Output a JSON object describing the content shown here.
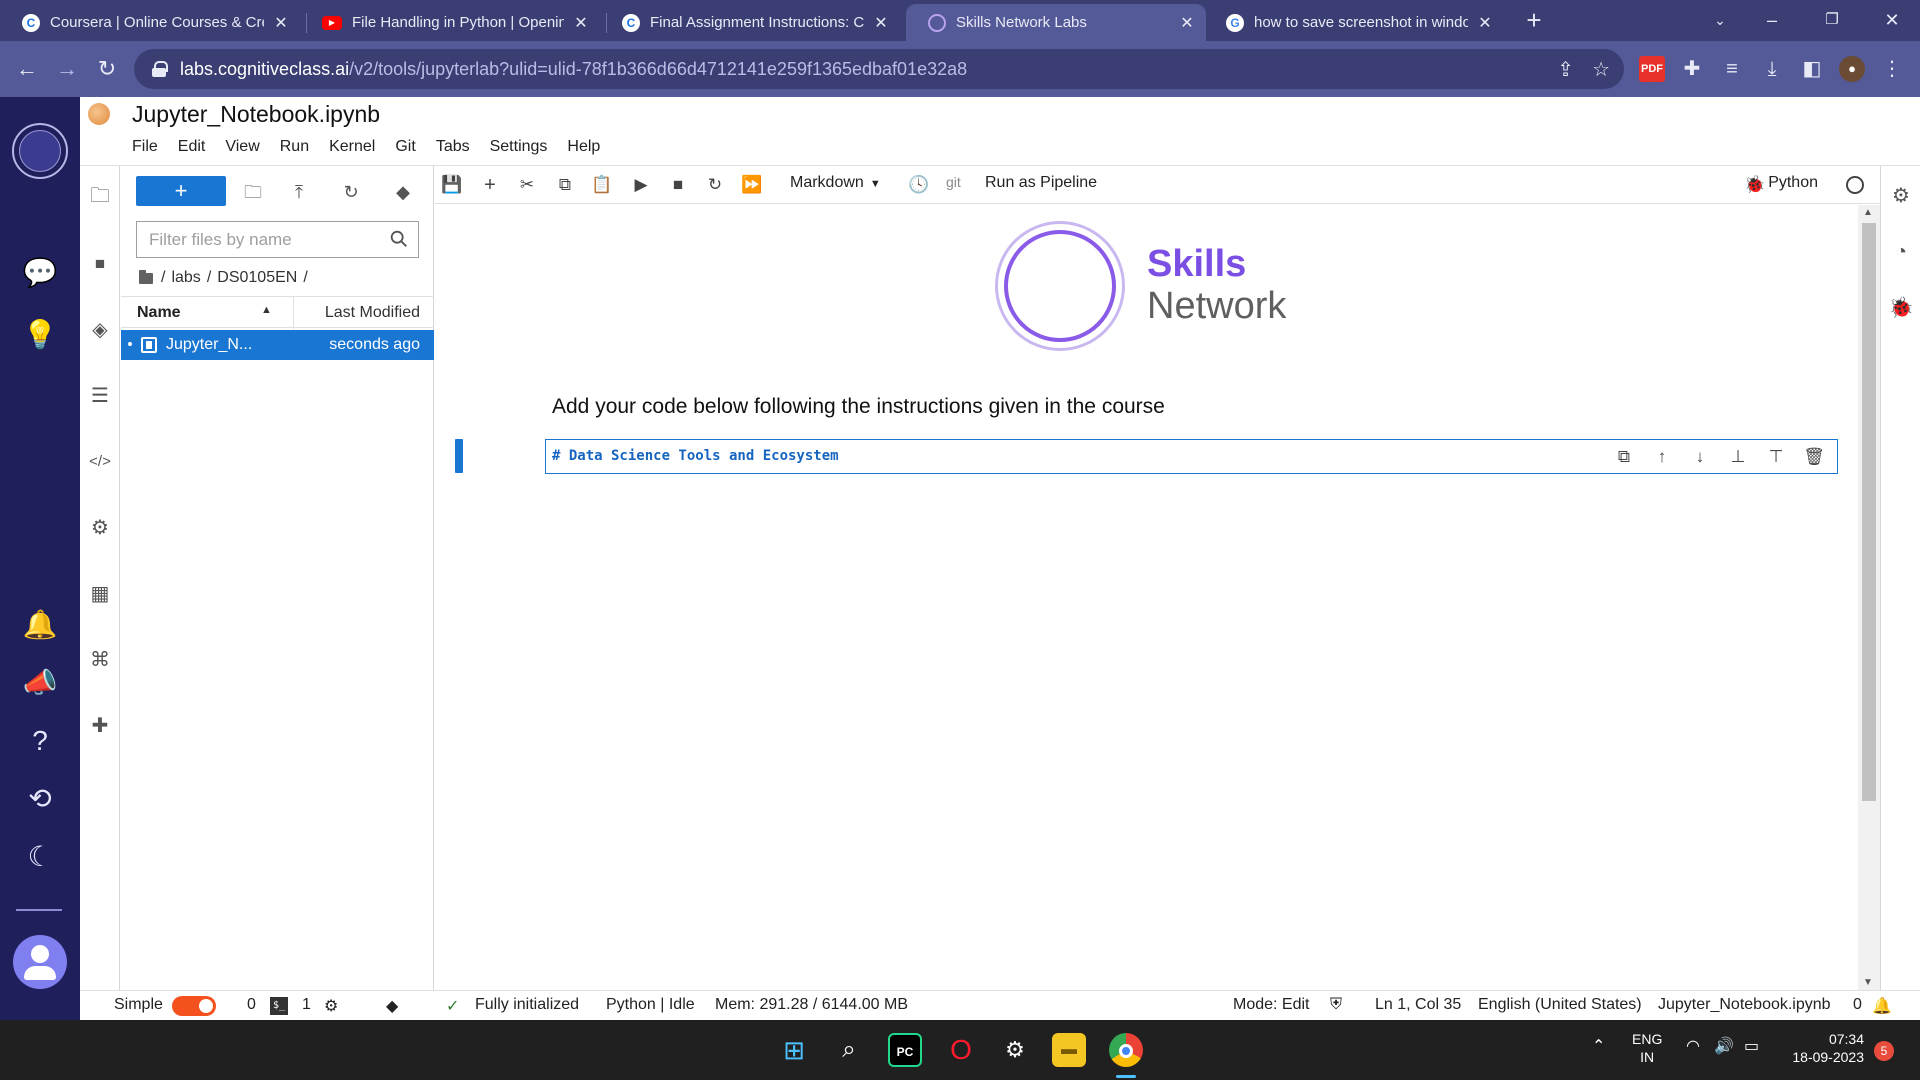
{
  "browser": {
    "tabs": [
      {
        "title": "Coursera | Online Courses & Cred",
        "favicon": "coursera-icon",
        "color": "#1a73e8"
      },
      {
        "title": "File Handling in Python | Opening",
        "favicon": "youtube-icon",
        "color": "#ff0000"
      },
      {
        "title": "Final Assignment Instructions: Cre",
        "favicon": "coursera-icon",
        "color": "#1a73e8"
      },
      {
        "title": "Skills Network Labs",
        "favicon": "skills-network-icon",
        "color": "#7b4fe3"
      },
      {
        "title": "how to save screenshot in windo",
        "favicon": "google-icon",
        "color": "#4285f4"
      }
    ],
    "url_host": "labs.cognitiveclass.ai",
    "url_path": "/v2/tools/jupyterlab?ulid=ulid-78f1b366d66d4712141e259f1365edbaf01e32a8"
  },
  "jupyter": {
    "document_title": "Jupyter_Notebook.ipynb",
    "menu": [
      "File",
      "Edit",
      "View",
      "Run",
      "Kernel",
      "Git",
      "Tabs",
      "Settings",
      "Help"
    ],
    "filebrowser": {
      "new_button": "+",
      "filter_placeholder": "Filter files by name",
      "breadcrumb": [
        "/",
        "labs",
        "/",
        "DS0105EN",
        "/"
      ],
      "col_name": "Name",
      "col_modified": "Last Modified",
      "files": [
        {
          "name": "Jupyter_N...",
          "modified": "seconds ago"
        }
      ]
    },
    "toolbar": {
      "cell_type": "Markdown",
      "git_label": "git",
      "pipeline_label": "Run as Pipeline",
      "kernel_name": "Python"
    },
    "notebook": {
      "logo_line1": "Skills",
      "logo_line2": "Network",
      "instructions": "Add your code below following the instructions given in the course",
      "cell_source": "# Data Science Tools and Ecosystem"
    },
    "statusbar": {
      "mode_toggle_label": "Simple",
      "terminals_count": "0",
      "kernels_count": "1",
      "init_status": "Fully initialized",
      "kernel_status": "Python | Idle",
      "memory": "Mem: 291.28 / 6144.00 MB",
      "edit_mode": "Mode: Edit",
      "cursor_pos": "Ln 1, Col 35",
      "language": "English (United States)",
      "filename": "Jupyter_Notebook.ipynb",
      "notifications": "0"
    }
  },
  "taskbar": {
    "lang_line1": "ENG",
    "lang_line2": "IN",
    "time": "07:34",
    "date": "18-09-2023",
    "notification_count": "5"
  },
  "colors": {
    "accent": "#1976d2",
    "rail": "#1f1f5c",
    "chrome_tabstrip": "#3a3e73",
    "chrome_toolbar": "#545a98",
    "brand_purple": "#7b4fe3"
  }
}
